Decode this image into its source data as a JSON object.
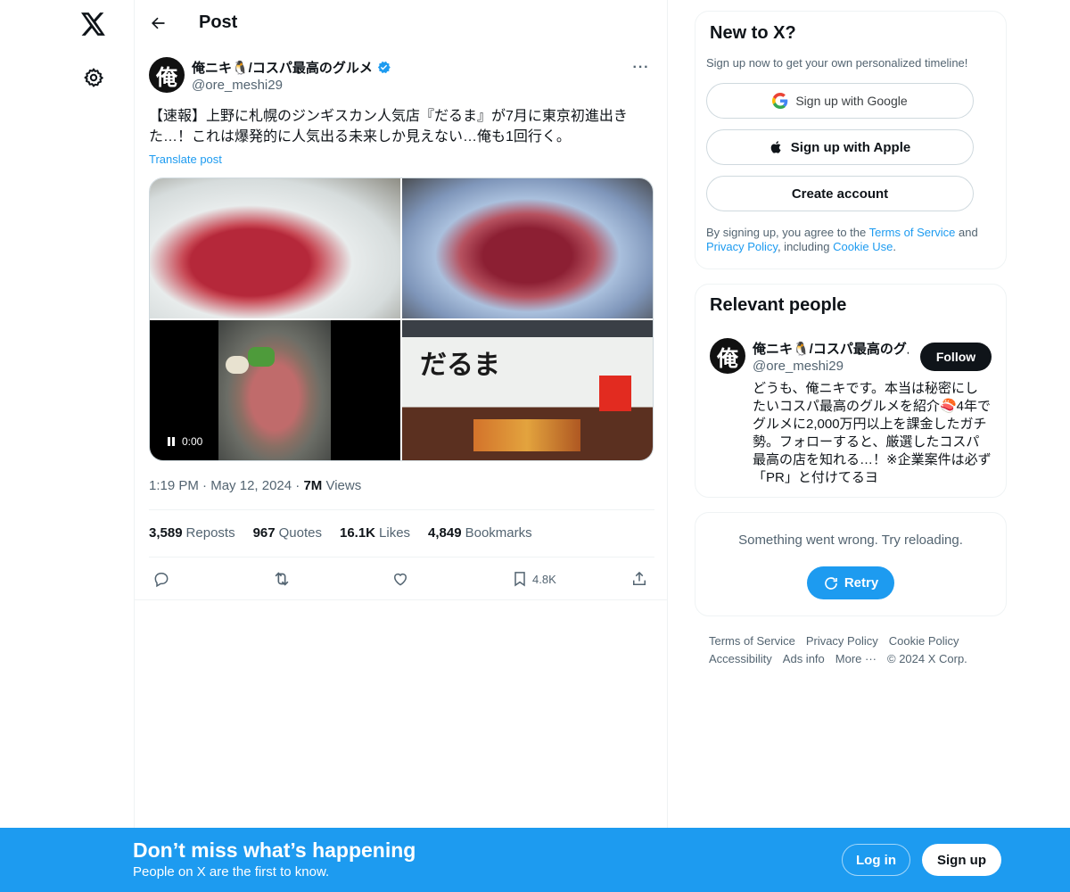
{
  "colors": {
    "accent": "#1d9bf0",
    "text": "#0f1419",
    "muted": "#536471",
    "border": "#eff3f4"
  },
  "header": {
    "title": "Post"
  },
  "post": {
    "author_name": "俺ニキ🐧/コスパ最高のグルメ",
    "author_handle": "@ore_meshi29",
    "avatar_char": "俺",
    "text": "【速報】上野に札幌のジンギスカン人気店『だるま』が7月に東京初進出きた…！これは爆発的に人気出る未来しか見えない…俺も1回行く。",
    "translate": "Translate post",
    "video_time": "0:00",
    "store_sign": "だるま",
    "time": "1:19 PM",
    "date": "May 12, 2024",
    "views_count": "7M",
    "views_label": "Views",
    "stats": {
      "reposts_count": "3,589",
      "reposts_label": "Reposts",
      "quotes_count": "967",
      "quotes_label": "Quotes",
      "likes_count": "16.1K",
      "likes_label": "Likes",
      "bookmarks_count": "4,849",
      "bookmarks_label": "Bookmarks"
    },
    "bookmark_action_count": "4.8K"
  },
  "signup_card": {
    "title": "New to X?",
    "subtitle": "Sign up now to get your own personalized timeline!",
    "google_label": "Sign up with Google",
    "apple_label": "Sign up with Apple",
    "create_label": "Create account",
    "legal_1": "By signing up, you agree to the ",
    "terms": "Terms of Service",
    "legal_2": " and ",
    "privacy": "Privacy Policy",
    "legal_3": ", including ",
    "cookie": "Cookie Use",
    "legal_4": "."
  },
  "relevant": {
    "title": "Relevant people",
    "name": "俺ニキ🐧/コスパ最高のグルメ",
    "handle": "@ore_meshi29",
    "follow_label": "Follow",
    "bio": "どうも、俺ニキです。本当は秘密にしたいコスパ最高のグルメを紹介🍣4年でグルメに2,000万円以上を課金したガチ勢。フォローすると、厳選したコスパ最高の店を知れる…！※企業案件は必ず「PR」と付けてるヨ"
  },
  "error_card": {
    "text": "Something went wrong. Try reloading.",
    "retry_label": "Retry"
  },
  "footer": {
    "terms": "Terms of Service",
    "privacy": "Privacy Policy",
    "cookie": "Cookie Policy",
    "accessibility": "Accessibility",
    "ads": "Ads info",
    "more": "More ···",
    "copyright": "© 2024 X Corp."
  },
  "banner": {
    "title": "Don’t miss what’s happening",
    "subtitle": "People on X are the first to know.",
    "login_label": "Log in",
    "signup_label": "Sign up"
  }
}
